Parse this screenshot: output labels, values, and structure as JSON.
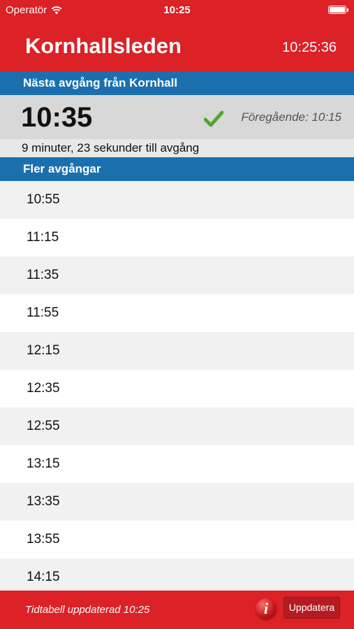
{
  "status_bar": {
    "carrier": "Operatör",
    "time": "10:25",
    "wifi_icon": "wifi-icon",
    "battery_icon": "battery-icon"
  },
  "header": {
    "title": "Kornhallsleden",
    "clock": "10:25:36"
  },
  "next_departure": {
    "section_label": "Nästa avgång från Kornhall",
    "time": "10:35",
    "status_icon": "check-icon",
    "previous": "Föregående: 10:15",
    "countdown": "9 minuter, 23 sekunder till avgång"
  },
  "more_departures": {
    "section_label": "Fler avgångar",
    "times": [
      "10:55",
      "11:15",
      "11:35",
      "11:55",
      "12:15",
      "12:35",
      "12:55",
      "13:15",
      "13:35",
      "13:55",
      "14:15"
    ]
  },
  "footer": {
    "updated_text": "Tidtabell uppdaterad 10:25",
    "info_icon": "info-icon",
    "update_button_label": "Uppdatera"
  },
  "colors": {
    "brand_red": "#dc2127",
    "section_blue": "#1b6fae",
    "check_green": "#4ea62e"
  }
}
